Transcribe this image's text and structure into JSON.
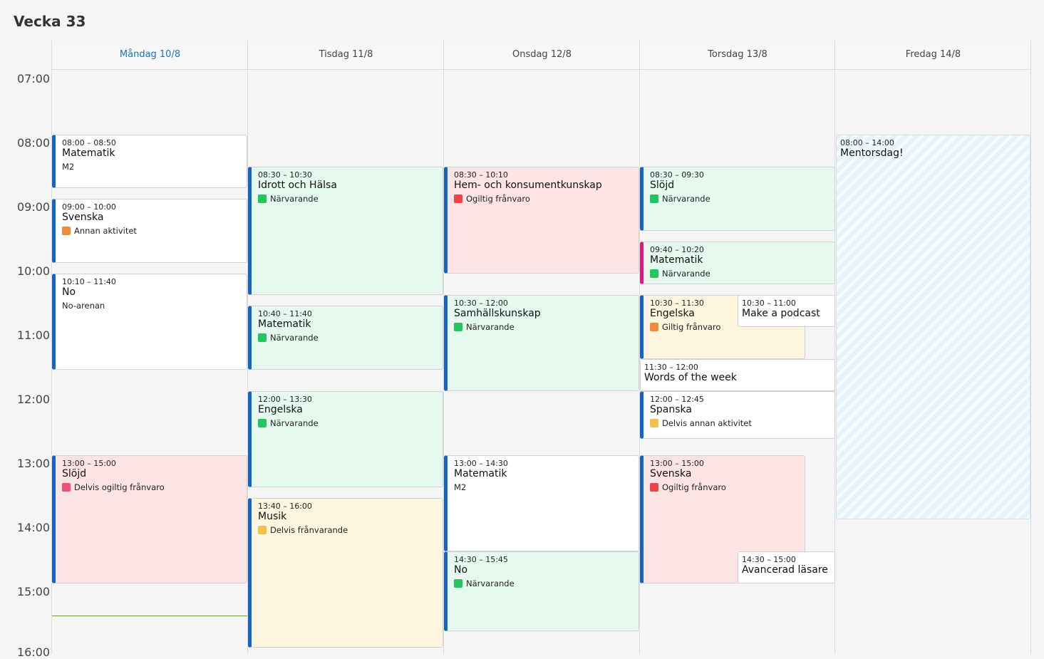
{
  "title": "Vecka 33",
  "hours": [
    "07:00",
    "08:00",
    "09:00",
    "10:00",
    "11:00",
    "12:00",
    "13:00",
    "14:00",
    "15:00",
    "16:00"
  ],
  "days": [
    {
      "label": "Måndag 10/8",
      "today": true
    },
    {
      "label": "Tisdag 11/8"
    },
    {
      "label": "Onsdag 12/8"
    },
    {
      "label": "Torsdag 13/8"
    },
    {
      "label": "Fredag 14/8"
    }
  ],
  "events": {
    "mon": [
      {
        "time": "08:00 – 08:50",
        "title": "Matematik",
        "sub": "M2"
      },
      {
        "time": "09:00 – 10:00",
        "title": "Svenska",
        "status": "Annan aktivitet"
      },
      {
        "time": "10:10 – 11:40",
        "title": "No",
        "sub": "No-arenan"
      },
      {
        "time": "13:00 – 15:00",
        "title": "Slöjd",
        "status": "Delvis ogiltig frånvaro"
      }
    ],
    "tue": [
      {
        "time": "08:30 – 10:30",
        "title": "Idrott och Hälsa",
        "status": "Närvarande"
      },
      {
        "time": "10:40 – 11:40",
        "title": "Matematik",
        "status": "Närvarande"
      },
      {
        "time": "12:00 – 13:30",
        "title": "Engelska",
        "status": "Närvarande"
      },
      {
        "time": "13:40 – 16:00",
        "title": "Musik",
        "status": "Delvis frånvarande"
      }
    ],
    "wed": [
      {
        "time": "08:30 – 10:10",
        "title": "Hem- och konsumentkunskap",
        "status": "Ogiltig frånvaro"
      },
      {
        "time": "10:30 – 12:00",
        "title": "Samhällskunskap",
        "status": "Närvarande"
      },
      {
        "time": "13:00 – 14:30",
        "title": "Matematik",
        "sub": "M2"
      },
      {
        "time": "14:30 – 15:45",
        "title": "No",
        "status": "Närvarande"
      }
    ],
    "thu": [
      {
        "time": "08:30 – 09:30",
        "title": "Slöjd",
        "status": "Närvarande"
      },
      {
        "time": "09:40 – 10:20",
        "title": "Matematik",
        "status": "Närvarande"
      },
      {
        "time": "10:30 – 11:30",
        "title": "Engelska",
        "status": "Giltig frånvaro"
      },
      {
        "time": "10:30 – 11:00",
        "title": "Make a podcast"
      },
      {
        "time": "11:30 – 12:00",
        "title": "Words of the week"
      },
      {
        "time": "12:00 – 12:45",
        "title": "Spanska",
        "status": "Delvis annan aktivitet"
      },
      {
        "time": "13:00 – 15:00",
        "title": "Svenska",
        "status": "Ogiltig frånvaro"
      },
      {
        "time": "14:30 – 15:00",
        "title": "Avancerad läsare"
      }
    ],
    "fri": [
      {
        "time": "08:00 – 14:00",
        "title": "Mentorsdag!"
      }
    ]
  },
  "colors": {
    "accent_blue": "#1565c0",
    "today_text": "#1a73c9",
    "status_present": "#22c55e",
    "status_other": "#f08a3c",
    "status_invalid": "#ef4444",
    "status_partial_invalid": "#f0507a",
    "status_partial_absent": "#f2c14e",
    "status_valid": "#f08a3c",
    "status_partial_other": "#f2c14e"
  }
}
